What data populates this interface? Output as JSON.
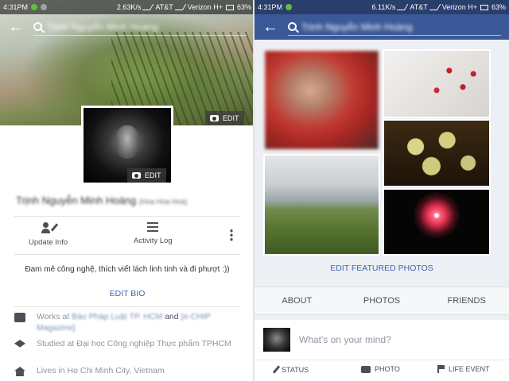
{
  "status_bar": {
    "left": {
      "time": "4:31PM",
      "speed": "2.63K/s",
      "carrier1": "AT&T",
      "carrier2": "Verizon H+",
      "battery": "63%"
    },
    "right": {
      "time": "4:31PM",
      "speed": "6.11K/s",
      "carrier1": "AT&T",
      "carrier2": "Verizon H+",
      "battery": "63%"
    }
  },
  "header": {
    "search_value": "Trịnh Nguyễn Minh Hoàng"
  },
  "profile": {
    "cover_edit_label": "EDIT",
    "avatar_edit_label": "EDIT",
    "name": "Trịnh Nguyễn Minh Hoàng",
    "nickname": "(Hoa Hoa Hoa)",
    "actions": {
      "update_info": "Update Info",
      "activity_log": "Activity Log"
    },
    "bio": "Đam mê công nghệ, thích viết lách linh tinh và đi phượt :))",
    "edit_bio": "EDIT BIO",
    "details": {
      "works_prefix": "Works at",
      "works_place1": "Báo Pháp Luật TP. HCM",
      "works_and": "and",
      "works_place2": "[e-CHIP Magazine]",
      "studied_prefix": "Studied at",
      "studied_place": "Đại học Công nghiệp Thực phẩm TPHCM",
      "lives_prefix": "Lives in",
      "lives_place": "Ho Chi Minh City, Vietnam"
    }
  },
  "featured": {
    "edit_label": "EDIT FEATURED PHOTOS"
  },
  "tabs": [
    "ABOUT",
    "PHOTOS",
    "FRIENDS"
  ],
  "composer": {
    "placeholder": "What's on your mind?",
    "actions": [
      "STATUS",
      "PHOTO",
      "LIFE EVENT"
    ]
  },
  "colors": {
    "facebook_blue": "#3b5998",
    "link_blue": "#4267b2",
    "text_dark": "#4b4f56",
    "text_grey": "#90949c"
  },
  "icons": {
    "back": "back-arrow-icon",
    "search": "search-icon",
    "camera": "camera-icon",
    "update_info": "user-edit-icon",
    "activity_log": "list-icon",
    "more": "more-vertical-icon",
    "work": "briefcase-icon",
    "school": "graduation-cap-icon",
    "home": "home-icon"
  }
}
